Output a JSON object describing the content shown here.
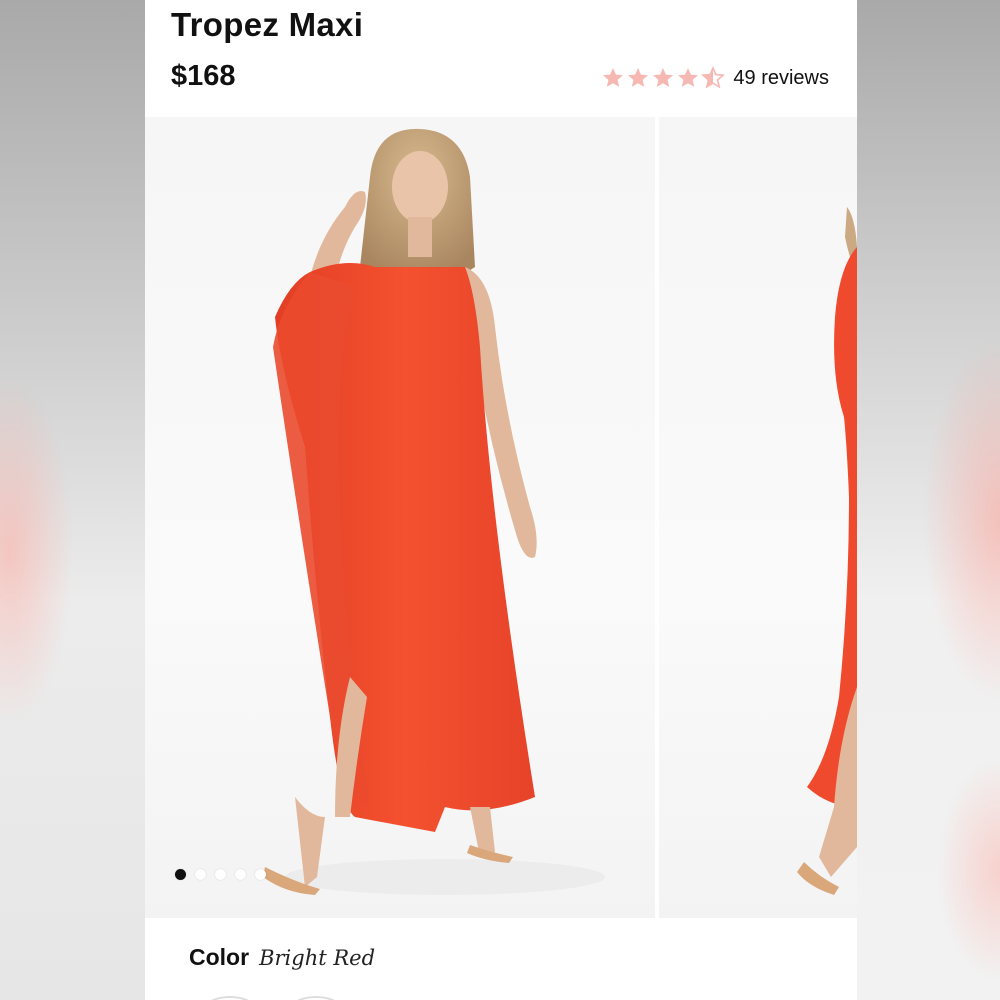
{
  "product": {
    "title": "Tropez Maxi",
    "price": "$168",
    "rating": 4.5,
    "review_count_label": "49 reviews"
  },
  "gallery": {
    "slide_count": 5,
    "active_slide": 1
  },
  "color": {
    "label": "Color",
    "value": "Bright Red"
  },
  "colors": {
    "star": "#f6b8b2",
    "dress": "#f0492f",
    "text": "#111111"
  }
}
